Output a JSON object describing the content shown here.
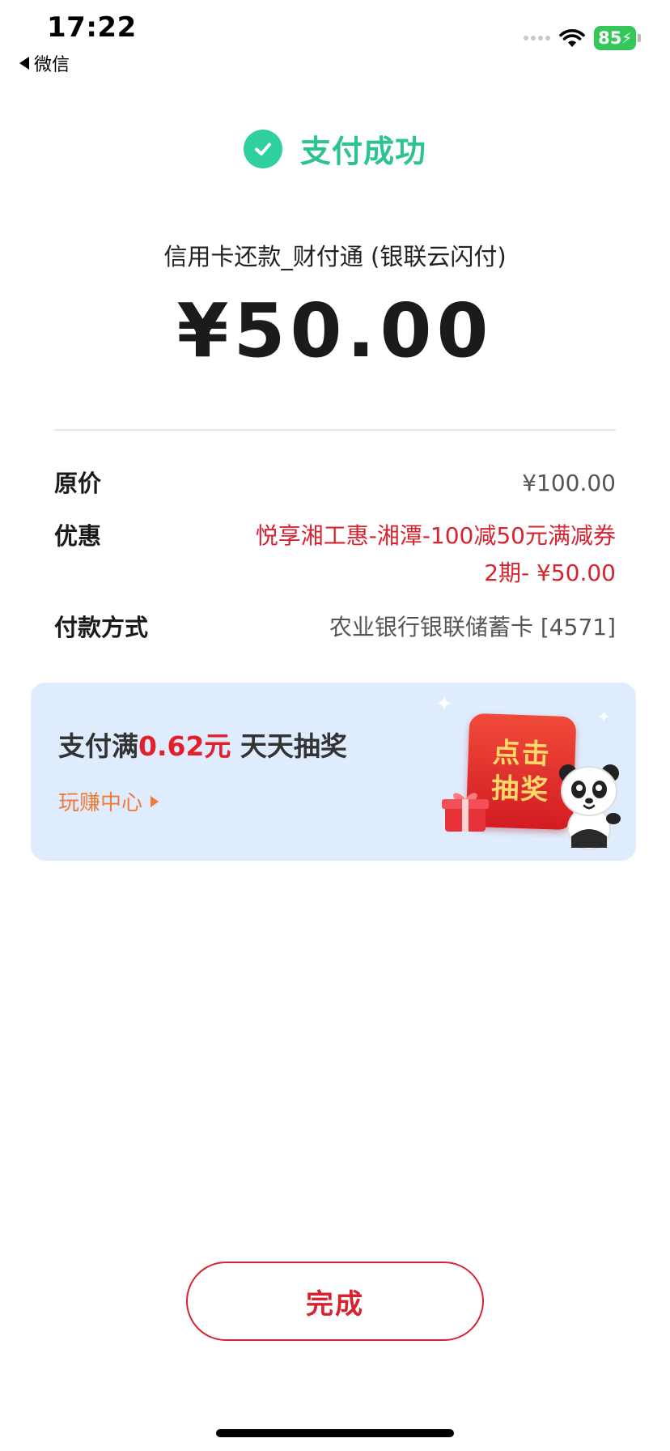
{
  "status_bar": {
    "time": "17:22",
    "back_app": "微信",
    "battery": "85"
  },
  "header": {
    "status": "支付成功"
  },
  "payment": {
    "merchant": "信用卡还款_财付通 (银联云闪付)",
    "amount": "¥50.00"
  },
  "details": [
    {
      "label": "原价",
      "value": "¥100.00"
    },
    {
      "label": "优惠",
      "value": "悦享湘工惠-湘潭-100减50元满减券2期- ¥50.00"
    },
    {
      "label": "付款方式",
      "value": "农业银行银联储蓄卡 [4571]"
    }
  ],
  "promo": {
    "title_prefix": "支付满",
    "title_highlight": "0.62元",
    "title_suffix": " 天天抽奖",
    "link": "玩赚中心",
    "card_line1": "点击",
    "card_line2": "抽奖"
  },
  "actions": {
    "done": "完成"
  },
  "colors": {
    "success_green": "#2bc394",
    "accent_red": "#d8232f",
    "promo_bg": "#dfecfd",
    "link_orange": "#f07a3a"
  }
}
